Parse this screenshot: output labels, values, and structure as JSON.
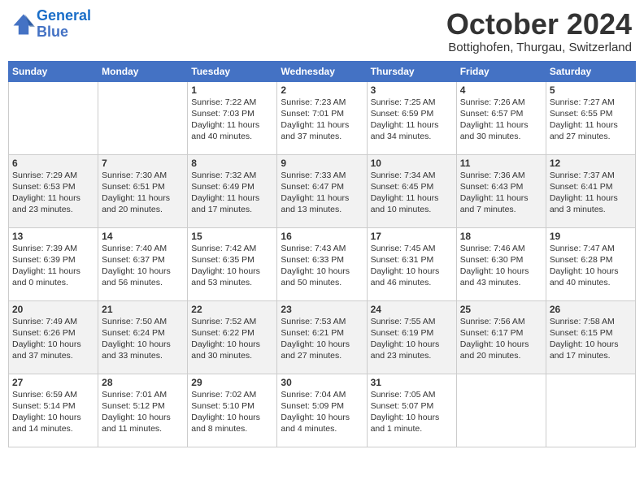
{
  "logo": {
    "line1": "General",
    "line2": "Blue"
  },
  "title": "October 2024",
  "location": "Bottighofen, Thurgau, Switzerland",
  "days_of_week": [
    "Sunday",
    "Monday",
    "Tuesday",
    "Wednesday",
    "Thursday",
    "Friday",
    "Saturday"
  ],
  "weeks": [
    [
      {
        "day": "",
        "detail": ""
      },
      {
        "day": "",
        "detail": ""
      },
      {
        "day": "1",
        "detail": "Sunrise: 7:22 AM\nSunset: 7:03 PM\nDaylight: 11 hours and 40 minutes."
      },
      {
        "day": "2",
        "detail": "Sunrise: 7:23 AM\nSunset: 7:01 PM\nDaylight: 11 hours and 37 minutes."
      },
      {
        "day": "3",
        "detail": "Sunrise: 7:25 AM\nSunset: 6:59 PM\nDaylight: 11 hours and 34 minutes."
      },
      {
        "day": "4",
        "detail": "Sunrise: 7:26 AM\nSunset: 6:57 PM\nDaylight: 11 hours and 30 minutes."
      },
      {
        "day": "5",
        "detail": "Sunrise: 7:27 AM\nSunset: 6:55 PM\nDaylight: 11 hours and 27 minutes."
      }
    ],
    [
      {
        "day": "6",
        "detail": "Sunrise: 7:29 AM\nSunset: 6:53 PM\nDaylight: 11 hours and 23 minutes."
      },
      {
        "day": "7",
        "detail": "Sunrise: 7:30 AM\nSunset: 6:51 PM\nDaylight: 11 hours and 20 minutes."
      },
      {
        "day": "8",
        "detail": "Sunrise: 7:32 AM\nSunset: 6:49 PM\nDaylight: 11 hours and 17 minutes."
      },
      {
        "day": "9",
        "detail": "Sunrise: 7:33 AM\nSunset: 6:47 PM\nDaylight: 11 hours and 13 minutes."
      },
      {
        "day": "10",
        "detail": "Sunrise: 7:34 AM\nSunset: 6:45 PM\nDaylight: 11 hours and 10 minutes."
      },
      {
        "day": "11",
        "detail": "Sunrise: 7:36 AM\nSunset: 6:43 PM\nDaylight: 11 hours and 7 minutes."
      },
      {
        "day": "12",
        "detail": "Sunrise: 7:37 AM\nSunset: 6:41 PM\nDaylight: 11 hours and 3 minutes."
      }
    ],
    [
      {
        "day": "13",
        "detail": "Sunrise: 7:39 AM\nSunset: 6:39 PM\nDaylight: 11 hours and 0 minutes."
      },
      {
        "day": "14",
        "detail": "Sunrise: 7:40 AM\nSunset: 6:37 PM\nDaylight: 10 hours and 56 minutes."
      },
      {
        "day": "15",
        "detail": "Sunrise: 7:42 AM\nSunset: 6:35 PM\nDaylight: 10 hours and 53 minutes."
      },
      {
        "day": "16",
        "detail": "Sunrise: 7:43 AM\nSunset: 6:33 PM\nDaylight: 10 hours and 50 minutes."
      },
      {
        "day": "17",
        "detail": "Sunrise: 7:45 AM\nSunset: 6:31 PM\nDaylight: 10 hours and 46 minutes."
      },
      {
        "day": "18",
        "detail": "Sunrise: 7:46 AM\nSunset: 6:30 PM\nDaylight: 10 hours and 43 minutes."
      },
      {
        "day": "19",
        "detail": "Sunrise: 7:47 AM\nSunset: 6:28 PM\nDaylight: 10 hours and 40 minutes."
      }
    ],
    [
      {
        "day": "20",
        "detail": "Sunrise: 7:49 AM\nSunset: 6:26 PM\nDaylight: 10 hours and 37 minutes."
      },
      {
        "day": "21",
        "detail": "Sunrise: 7:50 AM\nSunset: 6:24 PM\nDaylight: 10 hours and 33 minutes."
      },
      {
        "day": "22",
        "detail": "Sunrise: 7:52 AM\nSunset: 6:22 PM\nDaylight: 10 hours and 30 minutes."
      },
      {
        "day": "23",
        "detail": "Sunrise: 7:53 AM\nSunset: 6:21 PM\nDaylight: 10 hours and 27 minutes."
      },
      {
        "day": "24",
        "detail": "Sunrise: 7:55 AM\nSunset: 6:19 PM\nDaylight: 10 hours and 23 minutes."
      },
      {
        "day": "25",
        "detail": "Sunrise: 7:56 AM\nSunset: 6:17 PM\nDaylight: 10 hours and 20 minutes."
      },
      {
        "day": "26",
        "detail": "Sunrise: 7:58 AM\nSunset: 6:15 PM\nDaylight: 10 hours and 17 minutes."
      }
    ],
    [
      {
        "day": "27",
        "detail": "Sunrise: 6:59 AM\nSunset: 5:14 PM\nDaylight: 10 hours and 14 minutes."
      },
      {
        "day": "28",
        "detail": "Sunrise: 7:01 AM\nSunset: 5:12 PM\nDaylight: 10 hours and 11 minutes."
      },
      {
        "day": "29",
        "detail": "Sunrise: 7:02 AM\nSunset: 5:10 PM\nDaylight: 10 hours and 8 minutes."
      },
      {
        "day": "30",
        "detail": "Sunrise: 7:04 AM\nSunset: 5:09 PM\nDaylight: 10 hours and 4 minutes."
      },
      {
        "day": "31",
        "detail": "Sunrise: 7:05 AM\nSunset: 5:07 PM\nDaylight: 10 hours and 1 minute."
      },
      {
        "day": "",
        "detail": ""
      },
      {
        "day": "",
        "detail": ""
      }
    ]
  ]
}
